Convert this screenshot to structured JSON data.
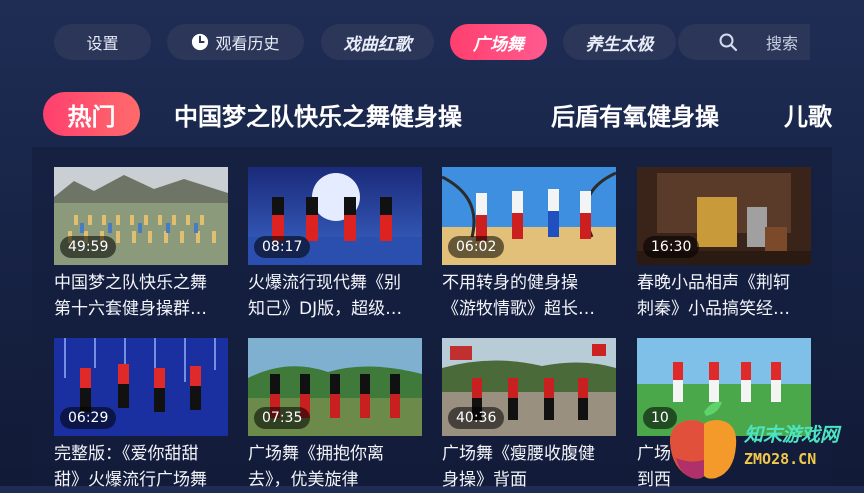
{
  "topbar": {
    "settings": "设置",
    "history": "观看历史",
    "opera": "戏曲红歌",
    "square_dance": "广场舞",
    "taiji": "养生太极",
    "search": "搜索"
  },
  "categories": {
    "hot": "热门",
    "cat1": "中国梦之队快乐之舞健身操",
    "cat2": "后盾有氧健身操",
    "cat3": "儿歌"
  },
  "videos": [
    {
      "duration": "49:59",
      "line1": "中国梦之队快乐之舞",
      "line2": "第十六套健身操群…"
    },
    {
      "duration": "08:17",
      "line1": "火爆流行现代舞《别",
      "line2": "知己》DJ版，超级…"
    },
    {
      "duration": "06:02",
      "line1": "不用转身的健身操",
      "line2": "《游牧情歌》超长…"
    },
    {
      "duration": "16:30",
      "line1": "春晚小品相声《荆轲",
      "line2": "刺秦》小品搞笑经…"
    },
    {
      "duration": "06:29",
      "line1": "完整版：《爱你甜甜",
      "line2": "甜》火爆流行广场舞"
    },
    {
      "duration": "07:35",
      "line1": "广场舞《拥抱你离",
      "line2": "去》，优美旋律"
    },
    {
      "duration": "40:36",
      "line1": "广场舞《瘦腰收腹健",
      "line2": "身操》背面"
    },
    {
      "duration": "10",
      "line1": "广场",
      "line2": "到西"
    }
  ],
  "watermark": {
    "name": "知末游戏网",
    "url": "ZMO28.CN"
  },
  "colors": {
    "accent": "#ff3f6e",
    "pill_bg": "#2b3659",
    "background": "#1c2850"
  }
}
